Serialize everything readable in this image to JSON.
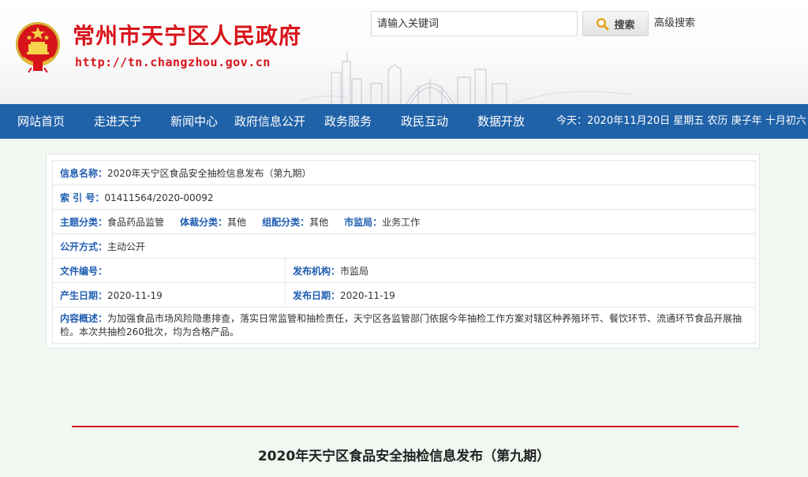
{
  "header": {
    "site_title": "常州市天宁区人民政府",
    "site_url": "http://tn.changzhou.gov.cn",
    "search": {
      "placeholder": "请输入关键词",
      "button_label": "搜索",
      "advanced_label": "高级搜索"
    }
  },
  "nav": {
    "items": [
      {
        "label": "网站首页"
      },
      {
        "label": "走进天宁"
      },
      {
        "label": "新闻中心"
      },
      {
        "label": "政府信息公开"
      },
      {
        "label": "政务服务"
      },
      {
        "label": "政民互动"
      },
      {
        "label": "数据开放"
      }
    ],
    "date_text": "今天：2020年11月20日 星期五 农历 庚子年 十月初六"
  },
  "info": {
    "name": {
      "label": "信息名称：",
      "value": "2020年天宁区食品安全抽检信息发布（第九期）"
    },
    "index_no": {
      "label": "索 引 号：",
      "value": "01411564/2020-00092"
    },
    "topic": {
      "label": "主题分类：",
      "value": "食品药品监管"
    },
    "genre": {
      "label": "体裁分类：",
      "value": "其他"
    },
    "org_category": {
      "label": "组配分类：",
      "value": "其他"
    },
    "bureau": {
      "label": "市监局：",
      "value": "业务工作"
    },
    "open_method": {
      "label": "公开方式：",
      "value": "主动公开"
    },
    "doc_no": {
      "label": "文件编号：",
      "value": ""
    },
    "publisher": {
      "label": "发布机构：",
      "value": "市监局"
    },
    "created": {
      "label": "产生日期：",
      "value": "2020-11-19"
    },
    "published": {
      "label": "发布日期：",
      "value": "2020-11-19"
    },
    "summary": {
      "label": "内容概述：",
      "value": "为加强食品市场风险隐患排查，落实日常监管和抽检责任，天宁区各监管部门依据今年抽检工作方案对辖区种养殖环节、餐饮环节、流通环节食品开展抽检。本次共抽检260批次，均为合格产品。"
    }
  },
  "article": {
    "title": "2020年天宁区食品安全抽检信息发布（第九期）"
  },
  "colors": {
    "nav_bg": "#2062a8",
    "title_red": "#d8141b",
    "label_blue": "#1f5eb2",
    "page_bg": "#f0f8f1"
  }
}
